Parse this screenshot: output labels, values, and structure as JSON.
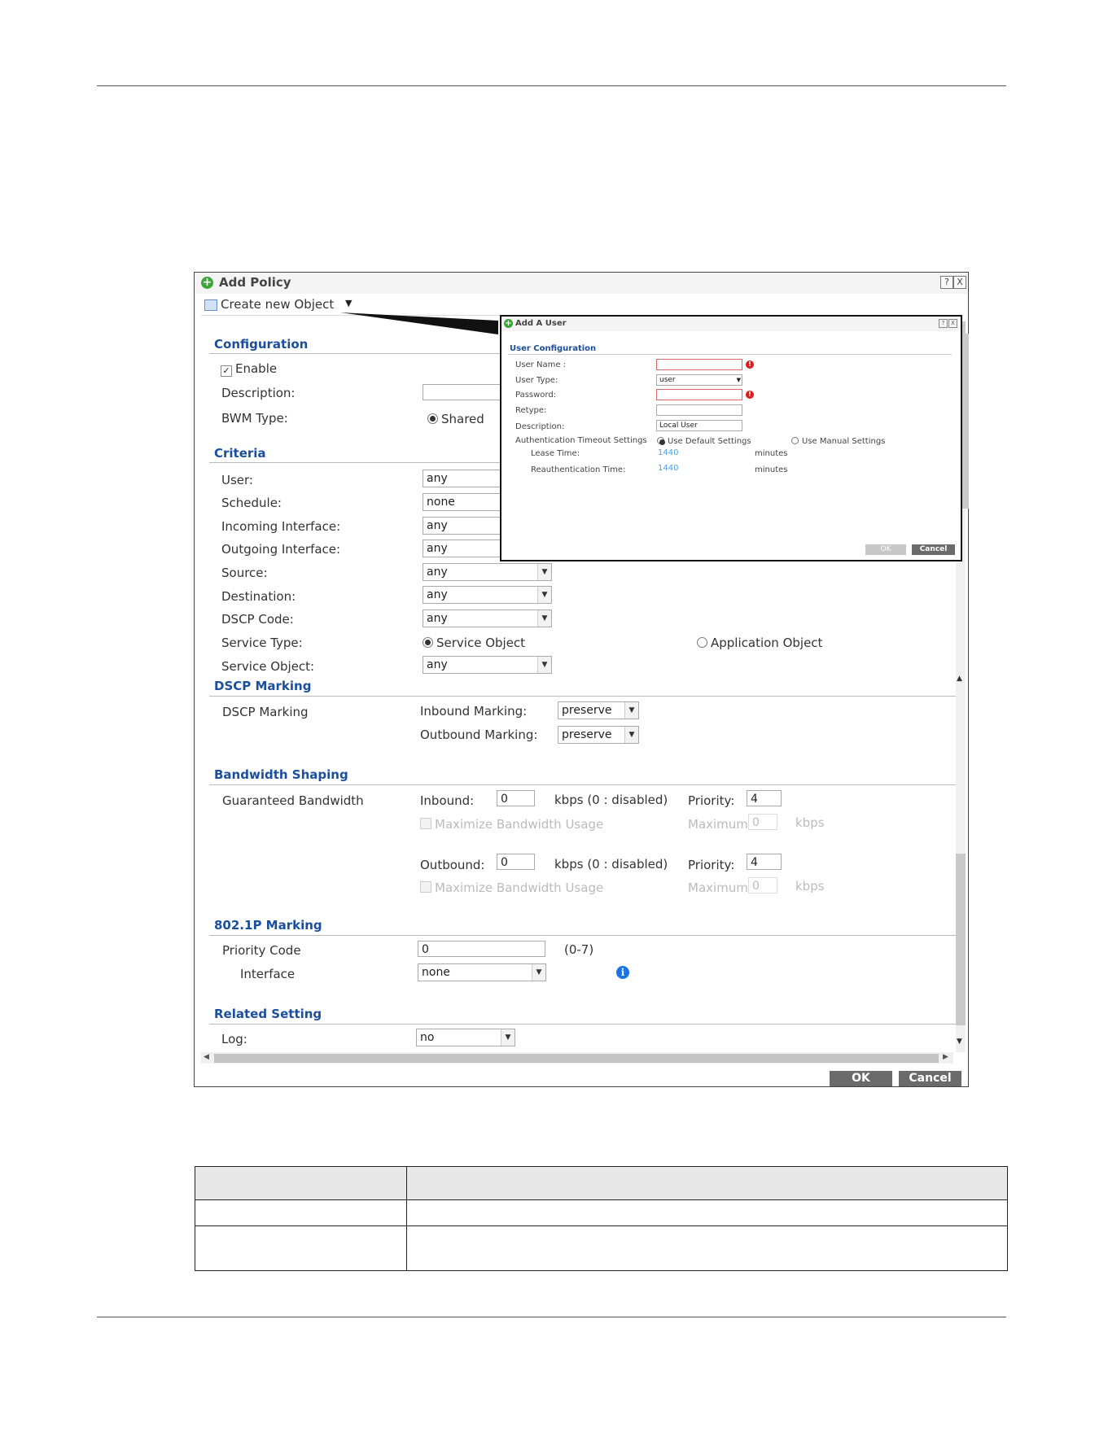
{
  "window": {
    "title": "Add Policy",
    "help_glyph": "?",
    "close_glyph": "X",
    "menu_create": "Create new Object",
    "menu_arrow": "▼"
  },
  "configuration": {
    "heading": "Configuration",
    "enable_label": "Enable",
    "enable_check": "✓",
    "description_label": "Description:",
    "bwm_type_label": "BWM Type:",
    "bwm_type_value": "Shared"
  },
  "criteria": {
    "heading": "Criteria",
    "rows": [
      {
        "label": "User:",
        "value": "any"
      },
      {
        "label": "Schedule:",
        "value": "none"
      },
      {
        "label": "Incoming Interface:",
        "value": "any"
      },
      {
        "label": "Outgoing Interface:",
        "value": "any"
      },
      {
        "label": "Source:",
        "value": "any"
      },
      {
        "label": "Destination:",
        "value": "any"
      },
      {
        "label": "DSCP Code:",
        "value": "any"
      }
    ],
    "service_type_label": "Service Type:",
    "service_object_option": "Service Object",
    "application_object_option": "Application Object",
    "service_object_label": "Service Object:",
    "service_object_value": "any"
  },
  "dscp_marking": {
    "heading": "DSCP Marking",
    "row_label": "DSCP Marking",
    "inbound_label": "Inbound Marking:",
    "inbound_value": "preserve",
    "outbound_label": "Outbound Marking:",
    "outbound_value": "preserve"
  },
  "bandwidth_shaping": {
    "heading": "Bandwidth Shaping",
    "row_label": "Guaranteed Bandwidth",
    "inbound_label": "Inbound:",
    "inbound_value": "0",
    "outbound_label": "Outbound:",
    "outbound_value": "0",
    "kbps_hint": "kbps (0 : disabled)",
    "priority_label": "Priority:",
    "inbound_priority": "4",
    "outbound_priority": "4",
    "maximize_label": "Maximize Bandwidth Usage",
    "maximum_label": "Maximum:",
    "maximum_value": "0",
    "kbps": "kbps"
  },
  "marking_8021p": {
    "heading": "802.1P Marking",
    "priority_code_label": "Priority Code",
    "priority_code_value": "0",
    "range_hint": "(0-7)",
    "interface_label": "Interface",
    "interface_value": "none",
    "info_glyph": "i"
  },
  "related_setting": {
    "heading": "Related Setting",
    "log_label": "Log:",
    "log_value": "no"
  },
  "buttons": {
    "ok": "OK",
    "cancel": "Cancel"
  },
  "popup": {
    "title": "Add A User",
    "heading": "User Configuration",
    "user_name_label": "User Name :",
    "user_type_label": "User Type:",
    "user_type_value": "user",
    "password_label": "Password:",
    "retype_label": "Retype:",
    "description_label": "Description:",
    "description_value": "Local User",
    "auth_timeout_label": "Authentication Timeout Settings",
    "use_default": "Use Default Settings",
    "use_manual": "Use Manual Settings",
    "lease_time_label": "Lease Time:",
    "lease_time_value": "1440",
    "reauth_label": "Reauthentication Time:",
    "reauth_value": "1440",
    "minutes": "minutes",
    "error_glyph": "!",
    "ok": "OK",
    "cancel": "Cancel"
  },
  "colors": {
    "section_heading": "#1b4f9c",
    "button_bg": "#6b6b6b",
    "add_icon": "#3aa635",
    "error": "#e01b1b",
    "info": "#1a73e8",
    "link_value": "#4aa3df"
  }
}
